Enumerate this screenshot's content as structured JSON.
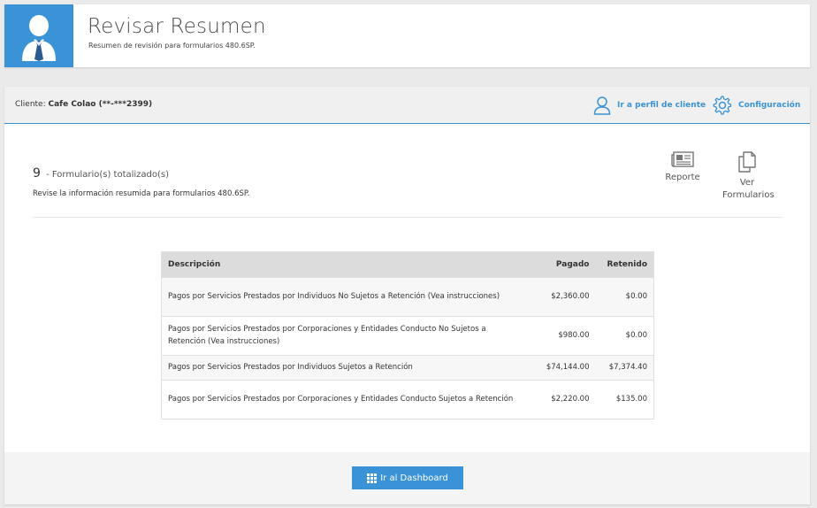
{
  "header": {
    "title": "Revisar Resumen",
    "subtitle": "Resumen de revisión para formularios 480.6SP."
  },
  "client_bar": {
    "client_label": "Cliente:",
    "client_name": "Cafe Colao (**-***2399)",
    "profile_link": "Ir a perfil de cliente",
    "config_link": "Configuración"
  },
  "summary": {
    "count": "9",
    "count_label": "- Formulario(s) totalizado(s)",
    "review_text": "Revise la información resumida para formularios 480.6SP."
  },
  "actions": {
    "report_label": "Reporte",
    "forms_label_line1": "Ver",
    "forms_label_line2": "Formularios"
  },
  "table": {
    "headers": [
      "Descripción",
      "Pagado",
      "Retenido"
    ],
    "rows": [
      {
        "description": "Pagos por Servicios Prestados por Individuos No Sujetos a Retención (Vea instrucciones)",
        "paid": "$2,360.00",
        "withheld": "$0.00"
      },
      {
        "description": "Pagos por Servicios Prestados por Corporaciones y Entidades Conducto No Sujetos a Retención (Vea instrucciones)",
        "paid": "$980.00",
        "withheld": "$0.00"
      },
      {
        "description": "Pagos por Servicios Prestados por Individuos Sujetos a Retención",
        "paid": "$74,144.00",
        "withheld": "$7,374.40"
      },
      {
        "description": "Pagos por Servicios Prestados por Corporaciones y Entidades Conducto Sujetos a Retención",
        "paid": "$2,220.00",
        "withheld": "$135.00"
      }
    ]
  },
  "footer": {
    "dashboard_button": "Ir al Dashboard"
  },
  "icons": {
    "avatar": "user-avatar-icon",
    "profile": "user-outline-icon",
    "config": "gear-icon",
    "report": "newspaper-icon",
    "forms": "copy-documents-icon",
    "dashboard": "grid-icon"
  },
  "colors": {
    "accent": "#3a93d6",
    "header_bg": "#dcdcdc"
  }
}
